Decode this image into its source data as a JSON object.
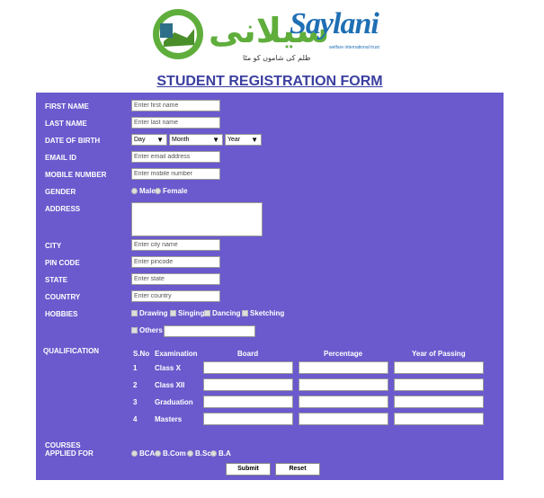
{
  "logo": {
    "urdu_text": "سیلانی",
    "english_text": "Saylani",
    "tagline": "welfare international trust",
    "subtitle": "ظلم کی شاموں کو مٹا"
  },
  "form_title": "STUDENT REGISTRATION FORM",
  "labels": {
    "first_name": "FIRST NAME",
    "last_name": "LAST NAME",
    "dob": "DATE OF BIRTH",
    "email": "EMAIL ID",
    "mobile": "MOBILE NUMBER",
    "gender": "GENDER",
    "address": "ADDRESS",
    "city": "CITY",
    "pin": "PIN CODE",
    "state": "STATE",
    "country": "COUNTRY",
    "hobbies": "HOBBIES",
    "qualification": "QUALIFICATION",
    "courses_line1": "COURSES",
    "courses_line2": "APPLIED FOR"
  },
  "placeholders": {
    "first_name": "Enter first name",
    "last_name": "Enter last name",
    "email": "Enter email address",
    "mobile": "Enter mobile number",
    "city": "Enter city name",
    "pin": "Enter pincode",
    "state": "Enter state",
    "country": "Enter country"
  },
  "dob": {
    "day": "Day",
    "month": "Month",
    "year": "Year"
  },
  "gender_options": [
    "Male",
    "Female"
  ],
  "hobbies": [
    "Drawing",
    "Singing",
    "Dancing",
    "Sketching"
  ],
  "others_label": "Others",
  "qualification_table": {
    "headers": [
      "S.No",
      "Examination",
      "Board",
      "Percentage",
      "Year of Passing"
    ],
    "rows": [
      {
        "sno": "1",
        "exam": "Class X"
      },
      {
        "sno": "2",
        "exam": "Class XII"
      },
      {
        "sno": "3",
        "exam": "Graduation"
      },
      {
        "sno": "4",
        "exam": "Masters"
      }
    ]
  },
  "courses": [
    "BCA",
    "B.Com",
    "B.Sc",
    "B.A"
  ],
  "buttons": {
    "submit": "Submit",
    "reset": "Reset"
  },
  "colors": {
    "panel": "#6a5acd",
    "title": "#3b3fa0",
    "logo_green": "#5fae3c",
    "logo_blue": "#1f6fb4"
  }
}
